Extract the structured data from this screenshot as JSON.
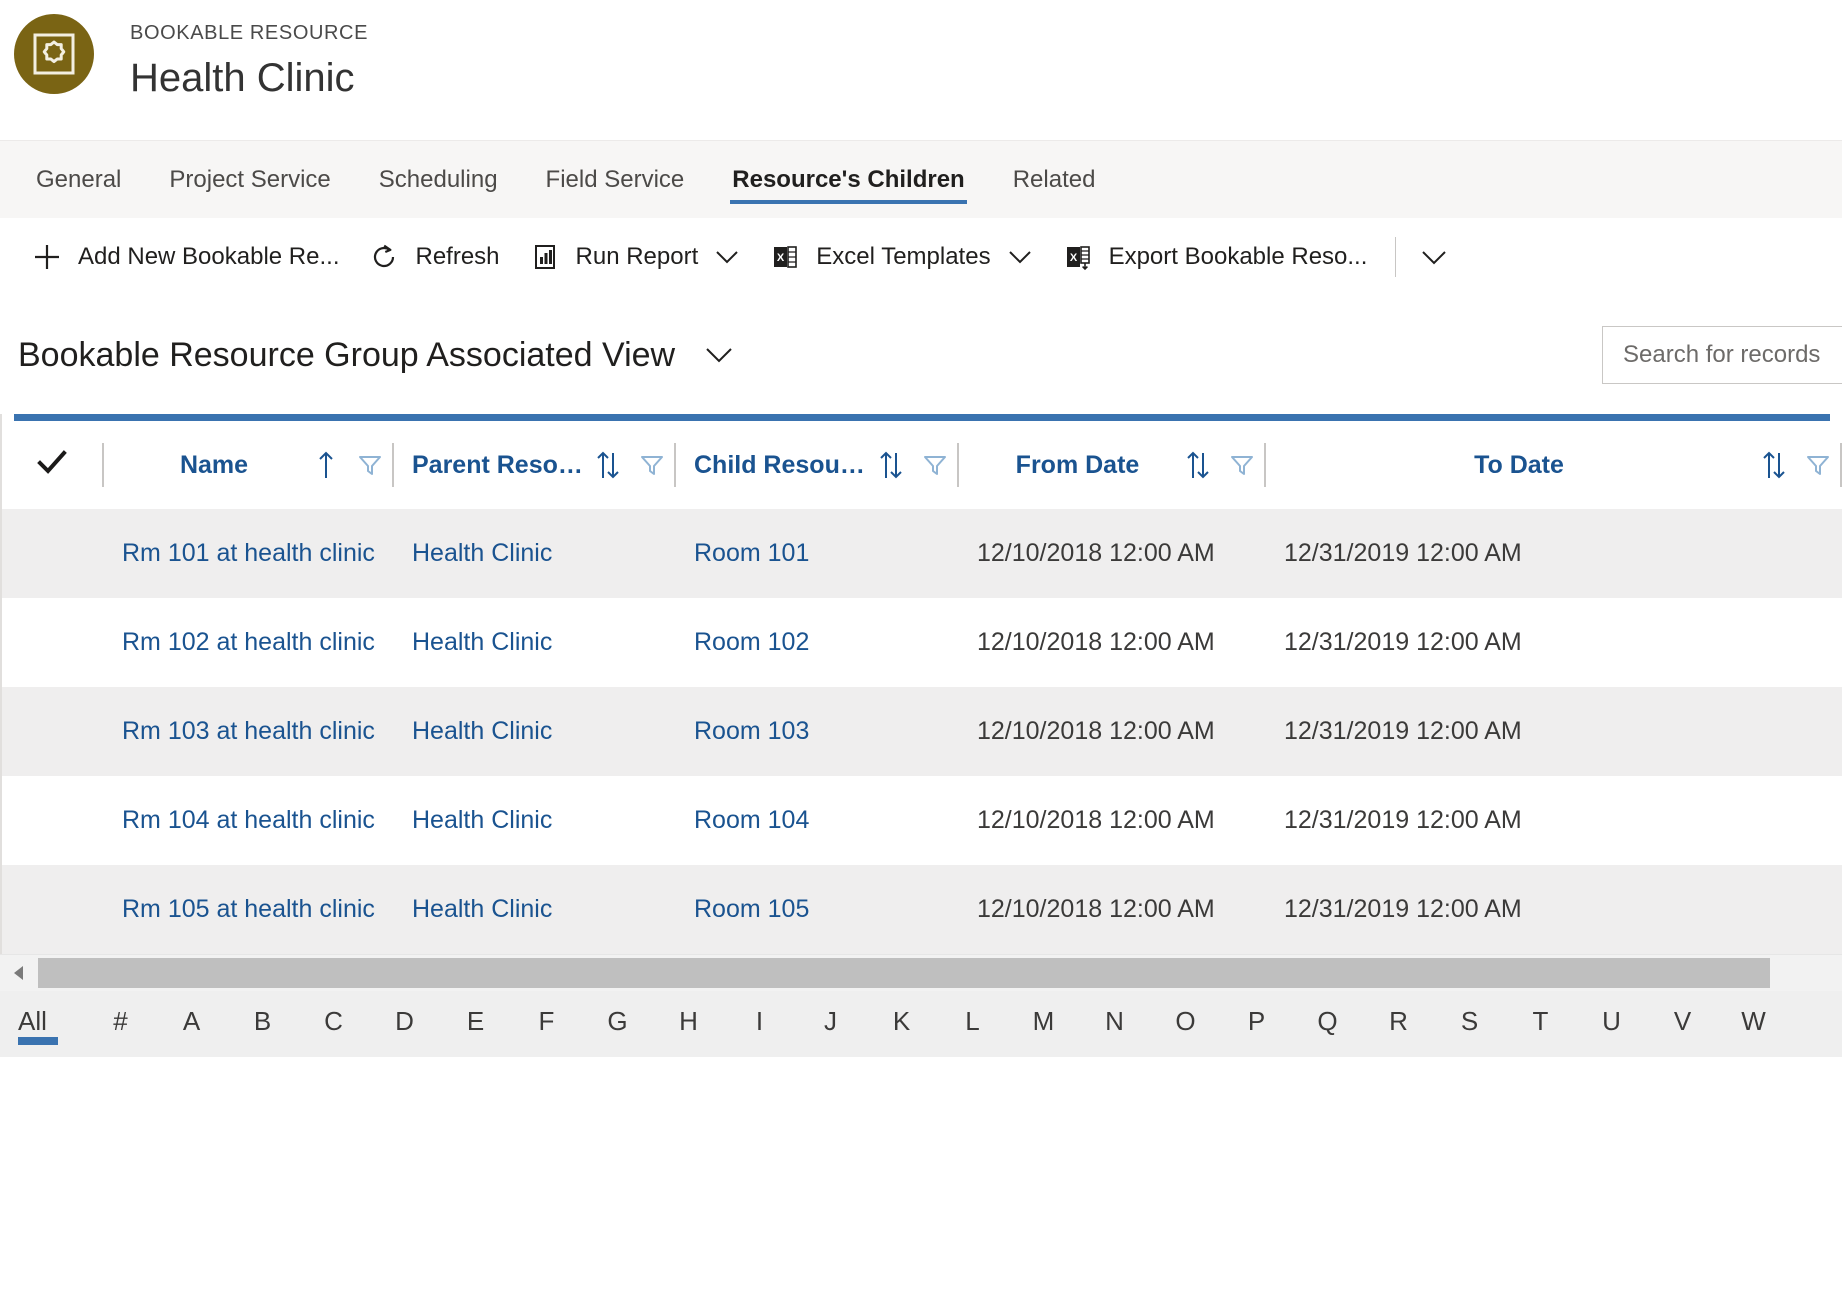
{
  "header": {
    "entity_label": "BOOKABLE RESOURCE",
    "record_name": "Health Clinic",
    "avatar_icon": "bookable-resource-icon",
    "avatar_color": "#7a6414"
  },
  "tabs": [
    {
      "label": "General",
      "active": false
    },
    {
      "label": "Project Service",
      "active": false
    },
    {
      "label": "Scheduling",
      "active": false
    },
    {
      "label": "Field Service",
      "active": false
    },
    {
      "label": "Resource's Children",
      "active": true
    },
    {
      "label": "Related",
      "active": false
    }
  ],
  "commandbar": {
    "items": [
      {
        "label": "Add New Bookable Re...",
        "icon": "plus-icon",
        "caret": false
      },
      {
        "label": "Refresh",
        "icon": "refresh-icon",
        "caret": false
      },
      {
        "label": "Run Report",
        "icon": "report-icon",
        "caret": true
      },
      {
        "label": "Excel Templates",
        "icon": "excel-icon",
        "caret": true
      },
      {
        "label": "Export Bookable Reso...",
        "icon": "excel-export-icon",
        "caret": true
      }
    ],
    "overflow_caret": "chevron-down-icon"
  },
  "view": {
    "title": "Bookable Resource Group Associated View",
    "caret_icon": "chevron-down-icon"
  },
  "search": {
    "placeholder": "Search for records",
    "value": ""
  },
  "grid": {
    "accent_color": "#3a73b0",
    "header_text_color": "#1a5390",
    "select_all_icon": "checkmark-icon",
    "columns": [
      {
        "label": "Name",
        "sort_icon": "sort-ascending-icon",
        "filter_icon": "filter-icon"
      },
      {
        "label": "Parent Resour...",
        "sort_icon": "sort-toggle-icon",
        "filter_icon": "filter-icon"
      },
      {
        "label": "Child Resource",
        "sort_icon": "sort-toggle-icon",
        "filter_icon": "filter-icon"
      },
      {
        "label": "From Date",
        "sort_icon": "sort-toggle-icon",
        "filter_icon": "filter-icon"
      },
      {
        "label": "To Date",
        "sort_icon": "sort-toggle-icon",
        "filter_icon": "filter-icon"
      }
    ],
    "rows": [
      {
        "name": "Rm 101 at health clinic",
        "parent_resource": "Health Clinic",
        "child_resource": "Room 101",
        "from_date": "12/10/2018 12:00 AM",
        "to_date": "12/31/2019 12:00 AM"
      },
      {
        "name": "Rm 102 at health clinic",
        "parent_resource": "Health Clinic",
        "child_resource": "Room 102",
        "from_date": "12/10/2018 12:00 AM",
        "to_date": "12/31/2019 12:00 AM"
      },
      {
        "name": "Rm 103 at health clinic",
        "parent_resource": "Health Clinic",
        "child_resource": "Room 103",
        "from_date": "12/10/2018 12:00 AM",
        "to_date": "12/31/2019 12:00 AM"
      },
      {
        "name": "Rm 104 at health clinic",
        "parent_resource": "Health Clinic",
        "child_resource": "Room 104",
        "from_date": "12/10/2018 12:00 AM",
        "to_date": "12/31/2019 12:00 AM"
      },
      {
        "name": "Rm 105 at health clinic",
        "parent_resource": "Health Clinic",
        "child_resource": "Room 105",
        "from_date": "12/10/2018 12:00 AM",
        "to_date": "12/31/2019 12:00 AM"
      }
    ]
  },
  "alphabet": {
    "active": "All",
    "items": [
      "All",
      "#",
      "A",
      "B",
      "C",
      "D",
      "E",
      "F",
      "G",
      "H",
      "I",
      "J",
      "K",
      "L",
      "M",
      "N",
      "O",
      "P",
      "Q",
      "R",
      "S",
      "T",
      "U",
      "V",
      "W"
    ]
  }
}
